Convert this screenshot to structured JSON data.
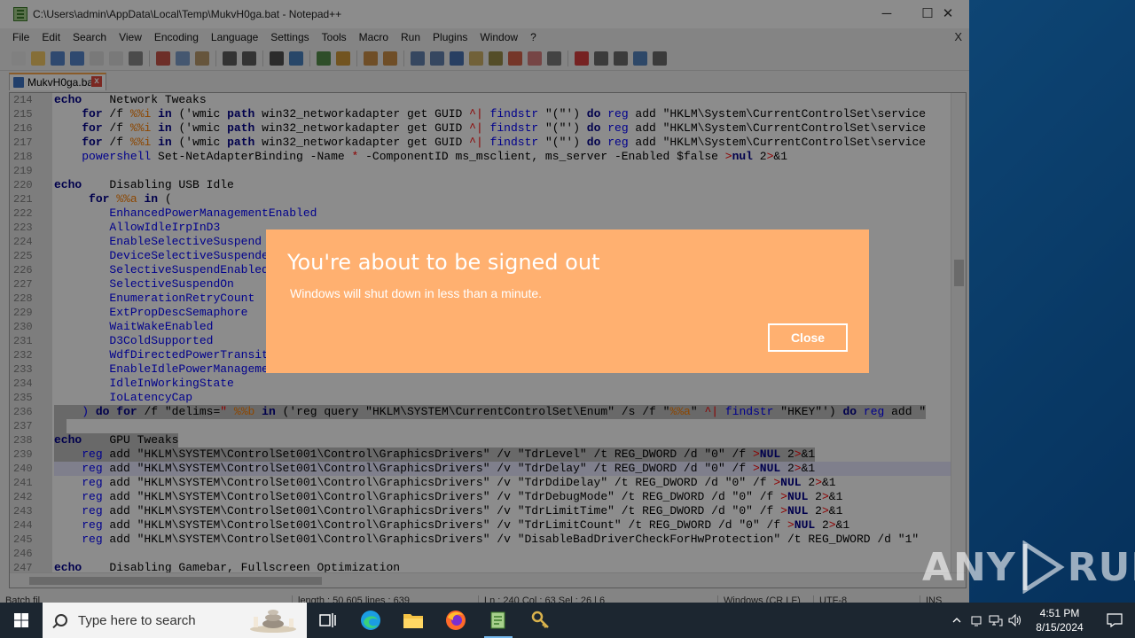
{
  "window": {
    "title": "C:\\Users\\admin\\AppData\\Local\\Temp\\MukvH0ga.bat - Notepad++",
    "minimize": "─",
    "maximize": "☐",
    "close": "✕"
  },
  "menu": {
    "items": [
      "File",
      "Edit",
      "Search",
      "View",
      "Encoding",
      "Language",
      "Settings",
      "Tools",
      "Macro",
      "Run",
      "Plugins",
      "Window",
      "?"
    ],
    "close": "X"
  },
  "tab": {
    "label": "MukvH0ga.bat",
    "close": "x"
  },
  "editor": {
    "lines": [
      {
        "n": "214",
        "hl": "",
        "tokens": [
          [
            "kw",
            "echo"
          ],
          [
            "",
            "    Network Tweaks"
          ]
        ]
      },
      {
        "n": "215",
        "hl": "",
        "tokens": [
          [
            "",
            "    "
          ],
          [
            "kw",
            "for"
          ],
          [
            "",
            " /f "
          ],
          [
            "var",
            "%%i"
          ],
          [
            "",
            " "
          ],
          [
            "kw",
            "in"
          ],
          [
            "",
            " ('wmic "
          ],
          [
            "kw",
            "path"
          ],
          [
            "",
            " win32_networkadapter get GUID "
          ],
          [
            "op",
            "^|"
          ],
          [
            "",
            " "
          ],
          [
            "cmd",
            "findstr"
          ],
          [
            "",
            " \"(\"') "
          ],
          [
            "kw",
            "do"
          ],
          [
            "",
            " "
          ],
          [
            "cmd",
            "reg"
          ],
          [
            "",
            " add \"HKLM\\System\\CurrentControlSet\\service"
          ]
        ]
      },
      {
        "n": "216",
        "hl": "",
        "tokens": [
          [
            "",
            "    "
          ],
          [
            "kw",
            "for"
          ],
          [
            "",
            " /f "
          ],
          [
            "var",
            "%%i"
          ],
          [
            "",
            " "
          ],
          [
            "kw",
            "in"
          ],
          [
            "",
            " ('wmic "
          ],
          [
            "kw",
            "path"
          ],
          [
            "",
            " win32_networkadapter get GUID "
          ],
          [
            "op",
            "^|"
          ],
          [
            "",
            " "
          ],
          [
            "cmd",
            "findstr"
          ],
          [
            "",
            " \"(\"') "
          ],
          [
            "kw",
            "do"
          ],
          [
            "",
            " "
          ],
          [
            "cmd",
            "reg"
          ],
          [
            "",
            " add \"HKLM\\System\\CurrentControlSet\\service"
          ]
        ]
      },
      {
        "n": "217",
        "hl": "",
        "tokens": [
          [
            "",
            "    "
          ],
          [
            "kw",
            "for"
          ],
          [
            "",
            " /f "
          ],
          [
            "var",
            "%%i"
          ],
          [
            "",
            " "
          ],
          [
            "kw",
            "in"
          ],
          [
            "",
            " ('wmic "
          ],
          [
            "kw",
            "path"
          ],
          [
            "",
            " win32_networkadapter get GUID "
          ],
          [
            "op",
            "^|"
          ],
          [
            "",
            " "
          ],
          [
            "cmd",
            "findstr"
          ],
          [
            "",
            " \"(\"') "
          ],
          [
            "kw",
            "do"
          ],
          [
            "",
            " "
          ],
          [
            "cmd",
            "reg"
          ],
          [
            "",
            " add \"HKLM\\System\\CurrentControlSet\\service"
          ]
        ]
      },
      {
        "n": "218",
        "hl": "",
        "tokens": [
          [
            "",
            "    "
          ],
          [
            "cmd",
            "powershell"
          ],
          [
            "",
            " Set-NetAdapterBinding -Name "
          ],
          [
            "op",
            "*"
          ],
          [
            "",
            " -ComponentID ms_msclient, ms_server -Enabled $false "
          ],
          [
            "op",
            ">"
          ],
          [
            "kw",
            "nul"
          ],
          [
            "",
            " 2"
          ],
          [
            "op",
            ">"
          ],
          [
            "",
            "&1"
          ]
        ]
      },
      {
        "n": "219",
        "hl": "",
        "tokens": []
      },
      {
        "n": "220",
        "hl": "",
        "tokens": [
          [
            "kw",
            "echo"
          ],
          [
            "",
            "    Disabling USB Idle"
          ]
        ]
      },
      {
        "n": "221",
        "hl": "",
        "tokens": [
          [
            "",
            "     "
          ],
          [
            "kw",
            "for"
          ],
          [
            "",
            " "
          ],
          [
            "var",
            "%%a"
          ],
          [
            "",
            " "
          ],
          [
            "kw",
            "in"
          ],
          [
            "",
            " ("
          ]
        ]
      },
      {
        "n": "222",
        "hl": "",
        "tokens": [
          [
            "",
            "        "
          ],
          [
            "cmd",
            "EnhancedPowerManagementEnabled"
          ]
        ]
      },
      {
        "n": "223",
        "hl": "",
        "tokens": [
          [
            "",
            "        "
          ],
          [
            "cmd",
            "AllowIdleIrpInD3"
          ]
        ]
      },
      {
        "n": "224",
        "hl": "",
        "tokens": [
          [
            "",
            "        "
          ],
          [
            "cmd",
            "EnableSelectiveSuspend"
          ]
        ]
      },
      {
        "n": "225",
        "hl": "",
        "tokens": [
          [
            "",
            "        "
          ],
          [
            "cmd",
            "DeviceSelectiveSuspended"
          ]
        ]
      },
      {
        "n": "226",
        "hl": "",
        "tokens": [
          [
            "",
            "        "
          ],
          [
            "cmd",
            "SelectiveSuspendEnabled"
          ]
        ]
      },
      {
        "n": "227",
        "hl": "",
        "tokens": [
          [
            "",
            "        "
          ],
          [
            "cmd",
            "SelectiveSuspendOn"
          ]
        ]
      },
      {
        "n": "228",
        "hl": "",
        "tokens": [
          [
            "",
            "        "
          ],
          [
            "cmd",
            "EnumerationRetryCount"
          ]
        ]
      },
      {
        "n": "229",
        "hl": "",
        "tokens": [
          [
            "",
            "        "
          ],
          [
            "cmd",
            "ExtPropDescSemaphore"
          ]
        ]
      },
      {
        "n": "230",
        "hl": "",
        "tokens": [
          [
            "",
            "        "
          ],
          [
            "cmd",
            "WaitWakeEnabled"
          ]
        ]
      },
      {
        "n": "231",
        "hl": "",
        "tokens": [
          [
            "",
            "        "
          ],
          [
            "cmd",
            "D3ColdSupported"
          ]
        ]
      },
      {
        "n": "232",
        "hl": "",
        "tokens": [
          [
            "",
            "        "
          ],
          [
            "cmd",
            "WdfDirectedPowerTransitionEnable"
          ]
        ]
      },
      {
        "n": "233",
        "hl": "",
        "tokens": [
          [
            "",
            "        "
          ],
          [
            "cmd",
            "EnableIdlePowerManagement"
          ]
        ]
      },
      {
        "n": "234",
        "hl": "",
        "tokens": [
          [
            "",
            "        "
          ],
          [
            "cmd",
            "IdleInWorkingState"
          ]
        ]
      },
      {
        "n": "235",
        "hl": "",
        "tokens": [
          [
            "",
            "        "
          ],
          [
            "cmd",
            "IoLatencyCap"
          ]
        ]
      },
      {
        "n": "236",
        "hl": "hl",
        "tokens": [
          [
            "",
            "    "
          ],
          [
            "cmd",
            ")"
          ],
          [
            "",
            " "
          ],
          [
            "kw",
            "do"
          ],
          [
            "",
            " "
          ],
          [
            "kw",
            "for"
          ],
          [
            "",
            " /f \"delims="
          ],
          [
            "op",
            "\""
          ],
          [
            "",
            " "
          ],
          [
            "var",
            "%%b"
          ],
          [
            "",
            " "
          ],
          [
            "kw",
            "in"
          ],
          [
            "",
            " ('reg query \"HKLM\\SYSTEM\\CurrentControlSet\\Enum\" /s /f \""
          ],
          [
            "var",
            "%%a"
          ],
          [
            "",
            "\" "
          ],
          [
            "op",
            "^|"
          ],
          [
            "",
            " "
          ],
          [
            "cmd",
            "findstr"
          ],
          [
            "",
            " \"HKEY\"') "
          ],
          [
            "kw",
            "do"
          ],
          [
            "",
            " "
          ],
          [
            "cmd",
            "reg"
          ],
          [
            "",
            " add \""
          ]
        ]
      },
      {
        "n": "237",
        "hl": "hl",
        "tokens": []
      },
      {
        "n": "238",
        "hl": "hl",
        "tokens": [
          [
            "kw",
            "echo"
          ],
          [
            "",
            "    GPU Tweaks"
          ]
        ]
      },
      {
        "n": "239",
        "hl": "hl",
        "tokens": [
          [
            "",
            "    "
          ],
          [
            "cmd",
            "reg"
          ],
          [
            "",
            " add \"HKLM\\SYSTEM\\ControlSet001\\Control\\GraphicsDrivers\" /v \"TdrLevel\" /t REG_DWORD /d \"0\" /f "
          ],
          [
            "op",
            ">"
          ],
          [
            "kw",
            "NUL"
          ],
          [
            "",
            " 2"
          ],
          [
            "op",
            ">"
          ],
          [
            "",
            "&1"
          ]
        ]
      },
      {
        "n": "240",
        "hl": "cur",
        "tokens": [
          [
            "",
            "    "
          ],
          [
            "cmd",
            "reg"
          ],
          [
            "",
            " add \"HKLM\\SYSTEM\\ControlSet001\\Control\\GraphicsDrivers\" /v \"TdrDelay\" /t REG_DWORD /d \"0\" /f "
          ],
          [
            "op",
            ">"
          ],
          [
            "kw",
            "NUL"
          ],
          [
            "",
            " 2"
          ],
          [
            "op",
            ">"
          ],
          [
            "",
            "&1"
          ]
        ]
      },
      {
        "n": "241",
        "hl": "",
        "tokens": [
          [
            "",
            "    "
          ],
          [
            "cmd",
            "reg"
          ],
          [
            "",
            " add \"HKLM\\SYSTEM\\ControlSet001\\Control\\GraphicsDrivers\" /v \"TdrDdiDelay\" /t REG_DWORD /d \"0\" /f "
          ],
          [
            "op",
            ">"
          ],
          [
            "kw",
            "NUL"
          ],
          [
            "",
            " 2"
          ],
          [
            "op",
            ">"
          ],
          [
            "",
            "&1"
          ]
        ]
      },
      {
        "n": "242",
        "hl": "",
        "tokens": [
          [
            "",
            "    "
          ],
          [
            "cmd",
            "reg"
          ],
          [
            "",
            " add \"HKLM\\SYSTEM\\ControlSet001\\Control\\GraphicsDrivers\" /v \"TdrDebugMode\" /t REG_DWORD /d \"0\" /f "
          ],
          [
            "op",
            ">"
          ],
          [
            "kw",
            "NUL"
          ],
          [
            "",
            " 2"
          ],
          [
            "op",
            ">"
          ],
          [
            "",
            "&1"
          ]
        ]
      },
      {
        "n": "243",
        "hl": "",
        "tokens": [
          [
            "",
            "    "
          ],
          [
            "cmd",
            "reg"
          ],
          [
            "",
            " add \"HKLM\\SYSTEM\\ControlSet001\\Control\\GraphicsDrivers\" /v \"TdrLimitTime\" /t REG_DWORD /d \"0\" /f "
          ],
          [
            "op",
            ">"
          ],
          [
            "kw",
            "NUL"
          ],
          [
            "",
            " 2"
          ],
          [
            "op",
            ">"
          ],
          [
            "",
            "&1"
          ]
        ]
      },
      {
        "n": "244",
        "hl": "",
        "tokens": [
          [
            "",
            "    "
          ],
          [
            "cmd",
            "reg"
          ],
          [
            "",
            " add \"HKLM\\SYSTEM\\ControlSet001\\Control\\GraphicsDrivers\" /v \"TdrLimitCount\" /t REG_DWORD /d \"0\" /f "
          ],
          [
            "op",
            ">"
          ],
          [
            "kw",
            "NUL"
          ],
          [
            "",
            " 2"
          ],
          [
            "op",
            ">"
          ],
          [
            "",
            "&1"
          ]
        ]
      },
      {
        "n": "245",
        "hl": "",
        "tokens": [
          [
            "",
            "    "
          ],
          [
            "cmd",
            "reg"
          ],
          [
            "",
            " add \"HKLM\\SYSTEM\\ControlSet001\\Control\\GraphicsDrivers\" /v \"DisableBadDriverCheckForHwProtection\" /t REG_DWORD /d \"1\""
          ]
        ]
      },
      {
        "n": "246",
        "hl": "",
        "tokens": []
      },
      {
        "n": "247",
        "hl": "",
        "tokens": [
          [
            "kw",
            "echo"
          ],
          [
            "",
            "    Disabling Gamebar, Fullscreen Optimization"
          ]
        ]
      }
    ]
  },
  "statusbar": {
    "type": "Batch fil",
    "length": "length : 50,605    lines : 639",
    "position": "Ln : 240    Col : 63    Sel : 26 | 6",
    "eol": "Windows (CR LF)",
    "encoding": "UTF-8",
    "mode": "INS"
  },
  "dialog": {
    "title": "You're about to be signed out",
    "message": "Windows will shut down in less than a minute.",
    "close_label": "Close",
    "color": "#ffb070"
  },
  "watermark": {
    "left": "ANY",
    "right": "RUN"
  },
  "taskbar": {
    "search_placeholder": "Type here to search",
    "icons": [
      "task-view-icon",
      "edge-icon",
      "file-explorer-icon",
      "firefox-icon",
      "notepadplusplus-icon",
      "keys-app-icon"
    ],
    "time": "4:51 PM",
    "date": "8/15/2024"
  }
}
